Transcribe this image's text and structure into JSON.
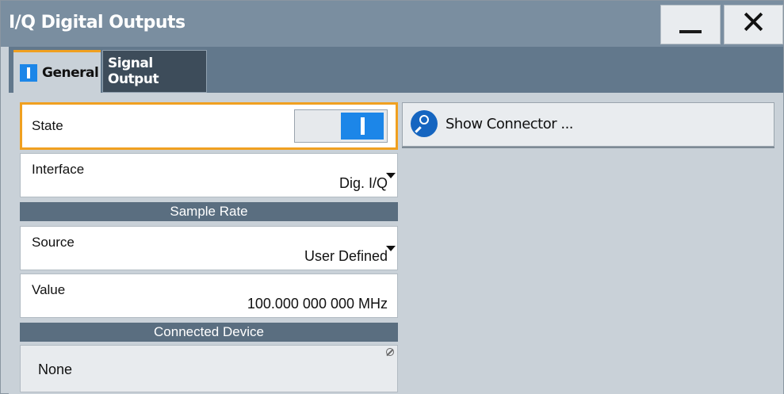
{
  "window": {
    "title": "I/Q Digital Outputs",
    "minimize_icon": "minimize-icon",
    "close_icon": "close-icon",
    "close_glyph": "✕"
  },
  "tabs": [
    {
      "label": "General",
      "active": true,
      "icon": "on-indicator-icon"
    },
    {
      "label": "Signal Output",
      "active": false
    }
  ],
  "general": {
    "state": {
      "label": "State",
      "value": "on"
    },
    "interface": {
      "label": "Interface",
      "value": "Dig. I/Q"
    },
    "sample_rate_header": "Sample Rate",
    "source": {
      "label": "Source",
      "value": "User Defined"
    },
    "value": {
      "label": "Value",
      "value": "100.000 000 000 MHz"
    },
    "connected_device_header": "Connected Device",
    "connected_device": {
      "value": "None",
      "icon": "disabled-icon"
    }
  },
  "show_connector": {
    "label": "Show Connector ...",
    "icon": "search-icon"
  },
  "colors": {
    "accent": "#f0a020",
    "active_blue": "#1c86e8",
    "titlebar": "#7a8ea0",
    "section_header": "#5a6e80"
  }
}
